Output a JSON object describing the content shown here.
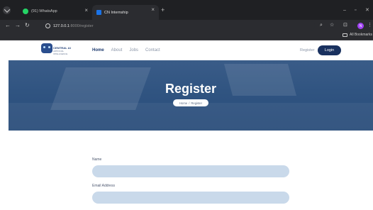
{
  "browser": {
    "tabs": [
      {
        "title": "(91) WhatsApp",
        "icon": "whatsapp-icon"
      },
      {
        "title": "CN Internship",
        "icon": "site-favicon"
      }
    ],
    "url_host": "127.0.0.1",
    "url_path": ":8000/register",
    "bookmarks_label": "All Bookmarks",
    "profile_initial": "N"
  },
  "site": {
    "logo_text": "CENTRAL AI",
    "logo_sub": "ARTIFICIAL INTELLIGENCE",
    "nav": [
      "Home",
      "About",
      "Jobs",
      "Contact"
    ],
    "register_link": "Register",
    "login_button": "Login"
  },
  "hero": {
    "title": "Register",
    "breadcrumb_home": "Home",
    "breadcrumb_sep": "/",
    "breadcrumb_current": "Register"
  },
  "form": {
    "name_label": "Name",
    "email_label": "Email Address"
  },
  "colors": {
    "nav_accent": "#19315f",
    "input_bg": "#c9d9ea",
    "hero_overlay": "#2f5380"
  }
}
